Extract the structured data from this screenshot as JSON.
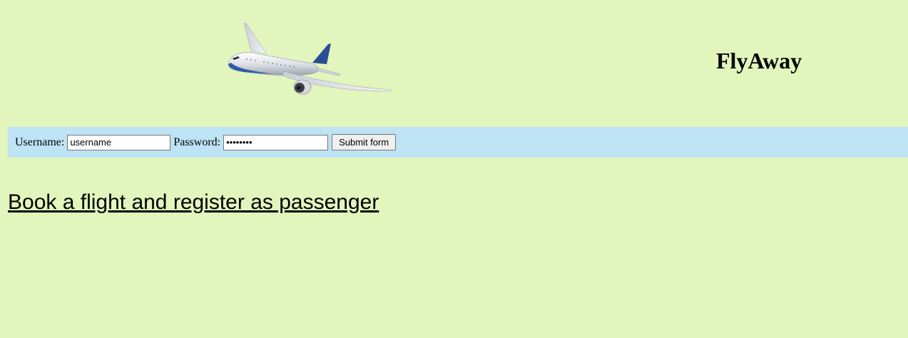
{
  "header": {
    "logo_icon": "airplane-icon",
    "brand_title": "FlyAway"
  },
  "login": {
    "username_label": "Username:",
    "username_value": "username",
    "password_label": "Password:",
    "password_value": "password",
    "submit_label": "Submit form"
  },
  "main": {
    "book_link": "Book a flight and register as passenger"
  },
  "colors": {
    "page_background": "#e2f5bd",
    "login_bar_background": "#bde3f4"
  }
}
